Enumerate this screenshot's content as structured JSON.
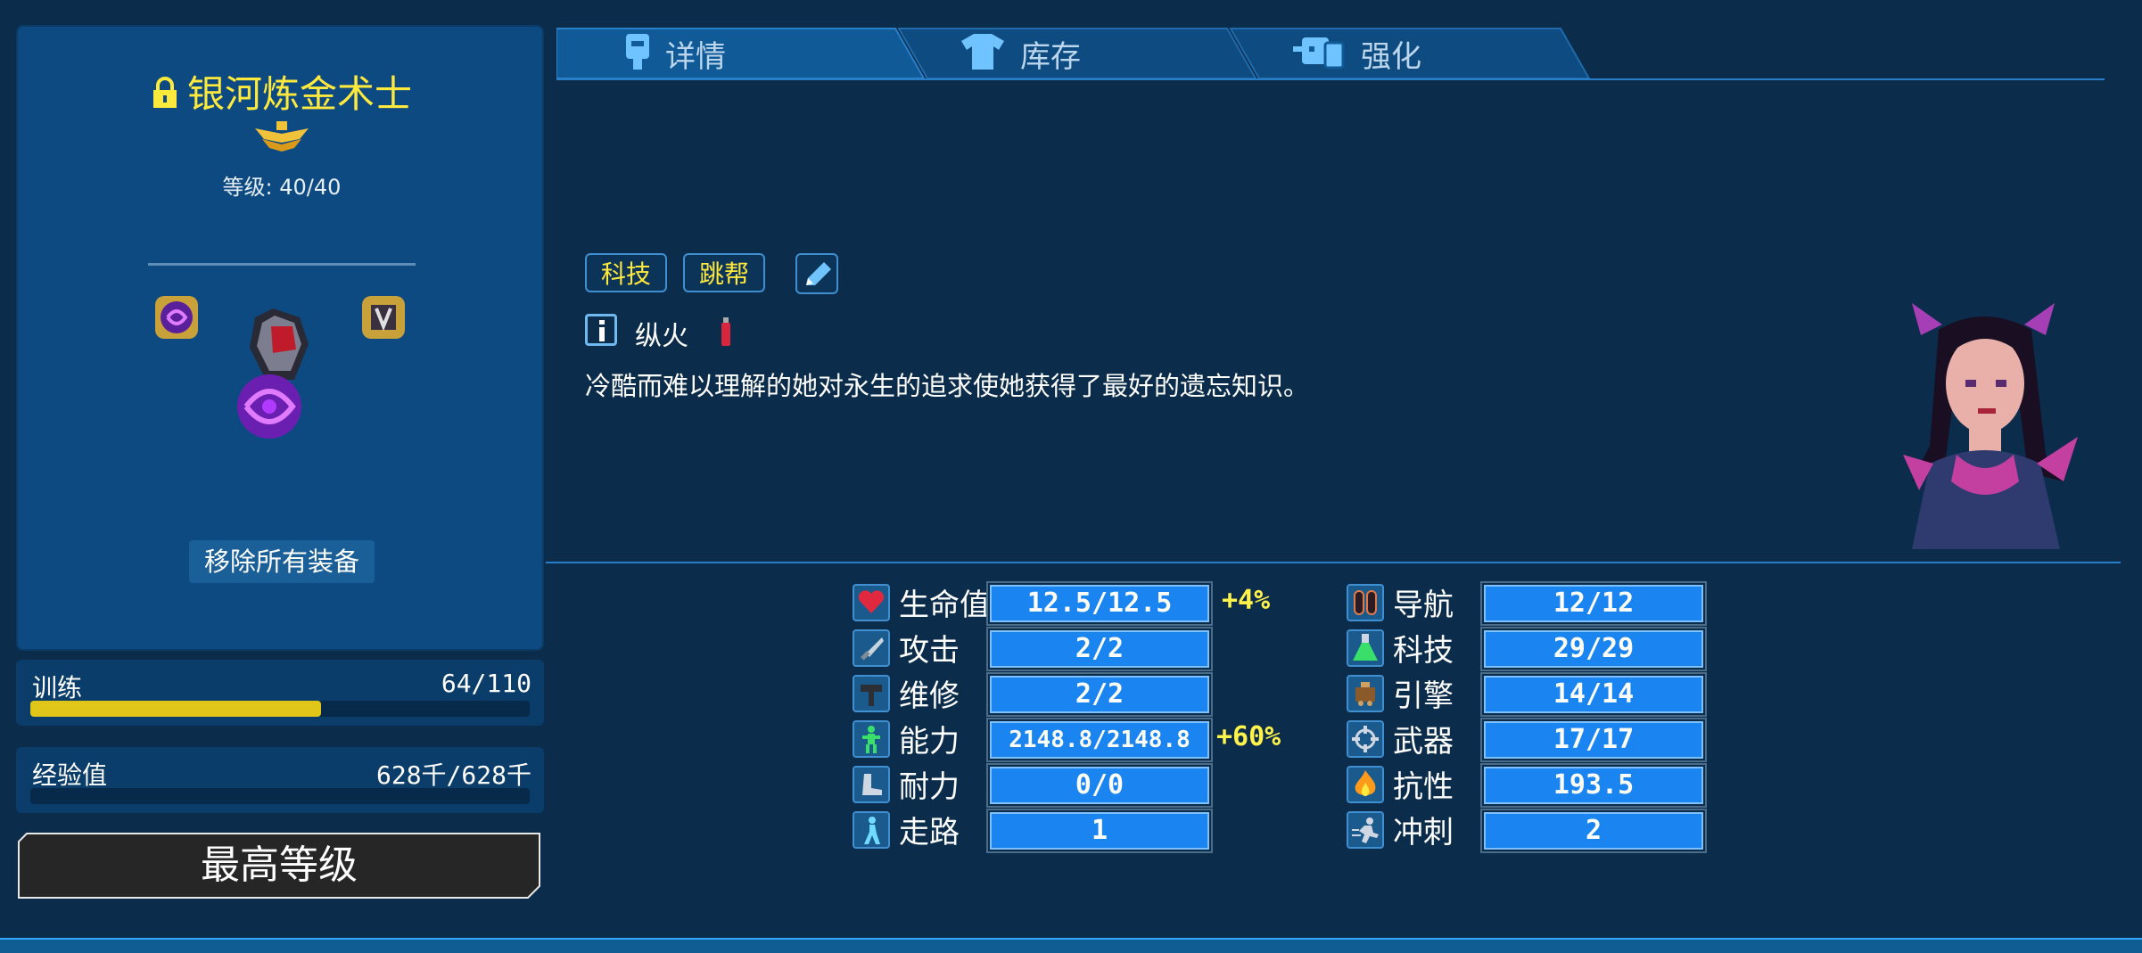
{
  "character": {
    "name": "银河炼金术士",
    "level_text": "等级: 40/40",
    "remove_equipment": "移除所有装备"
  },
  "progress": {
    "training": {
      "label": "训练",
      "value": "64/110",
      "fraction": 0.582
    },
    "experience": {
      "label": "经验值",
      "value": "628千/628千",
      "fraction": 1.0
    }
  },
  "max_level_button": "最高等级",
  "tabs": [
    {
      "label": "详情",
      "icon": "crew-icon"
    },
    {
      "label": "库存",
      "icon": "shirt-icon"
    },
    {
      "label": "强化",
      "icon": "enhance-icon"
    }
  ],
  "tags": [
    "科技",
    "跳帮"
  ],
  "trait": "纵火",
  "description": "冷酷而难以理解的她对永生的追求使她获得了最好的遗忘知识。",
  "stats_left": [
    {
      "label": "生命值",
      "value": "12.5/12.5",
      "bonus": "+4%",
      "icon": "heart-icon"
    },
    {
      "label": "攻击",
      "value": "2/2",
      "bonus": "",
      "icon": "sword-icon"
    },
    {
      "label": "维修",
      "value": "2/2",
      "bonus": "",
      "icon": "hammer-icon"
    },
    {
      "label": "能力",
      "value": "2148.8/2148.8",
      "bonus": "+60%",
      "icon": "ability-icon"
    },
    {
      "label": "耐力",
      "value": "0/0",
      "bonus": "",
      "icon": "boot-icon"
    },
    {
      "label": "走路",
      "value": "1",
      "bonus": "",
      "icon": "walk-icon"
    }
  ],
  "stats_right": [
    {
      "label": "导航",
      "value": "12/12",
      "icon": "pilot-icon"
    },
    {
      "label": "科技",
      "value": "29/29",
      "icon": "flask-icon"
    },
    {
      "label": "引擎",
      "value": "14/14",
      "icon": "engine-icon"
    },
    {
      "label": "武器",
      "value": "17/17",
      "icon": "crosshair-icon"
    },
    {
      "label": "抗性",
      "value": "193.5",
      "icon": "fire-icon"
    },
    {
      "label": "冲刺",
      "value": "2",
      "icon": "run-icon"
    }
  ],
  "colors": {
    "background": "#0b2c4b",
    "panel": "#0d4a82",
    "name_yellow": "#ffe93d",
    "stat_box": "#1a84f0",
    "bonus_yellow": "#fff24a",
    "training_bar": "#e0c619"
  }
}
